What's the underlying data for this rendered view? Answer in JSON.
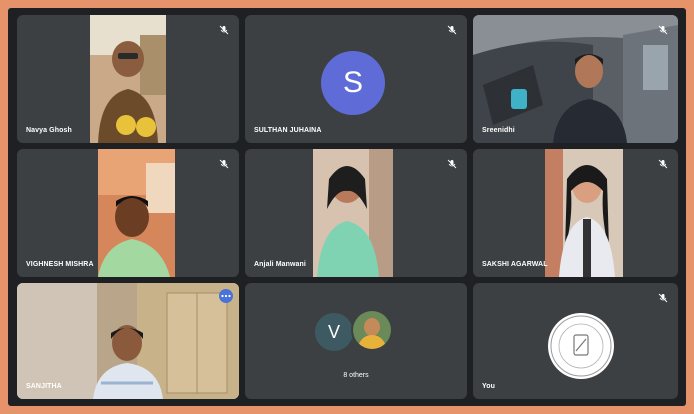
{
  "participants": [
    {
      "name": "Navya Ghosh"
    },
    {
      "name": "SULTHAN JUHAINA",
      "initial": "S"
    },
    {
      "name": "Sreenidhi"
    },
    {
      "name": "VIGHNESH MISHRA"
    },
    {
      "name": "Anjali Manwani"
    },
    {
      "name": "SAKSHI AGARWAL"
    },
    {
      "name": "SANJITHA"
    },
    {
      "others_initial": "V",
      "others_label": "8 others"
    },
    {
      "name": "You"
    }
  ],
  "icons": {
    "mic_off": "mic-off-icon",
    "more": "more-options-icon",
    "logo": "school-logo"
  },
  "colors": {
    "tile": "#3c4043",
    "avatar_s": "#5f6bd6",
    "avatar_v": "#3d5a63",
    "more_button": "#4a73d8",
    "background": "#1f2023"
  }
}
